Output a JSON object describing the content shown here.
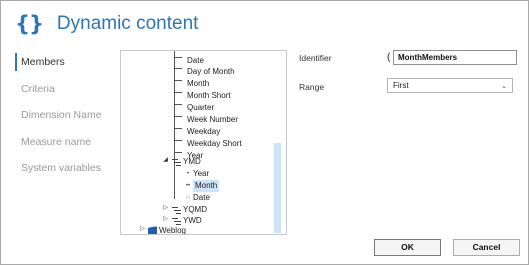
{
  "dialog": {
    "title_icon": "{}",
    "title": "Dynamic content"
  },
  "nav": {
    "items": [
      {
        "label": "Members"
      },
      {
        "label": "Criteria"
      },
      {
        "label": "Dimension Name"
      },
      {
        "label": "Measure name"
      },
      {
        "label": "System variables"
      }
    ],
    "active_index": 0
  },
  "tree": {
    "items": [
      {
        "label": "Date"
      },
      {
        "label": "Day of Month"
      },
      {
        "label": "Month"
      },
      {
        "label": "Month Short"
      },
      {
        "label": "Quarter"
      },
      {
        "label": "Week Number"
      },
      {
        "label": "Weekday"
      },
      {
        "label": "Weekday Short"
      },
      {
        "label": "Year"
      },
      {
        "label": "YMD",
        "expanded": true
      },
      {
        "label": "Year"
      },
      {
        "label": "Month",
        "selected": true
      },
      {
        "label": "Date"
      },
      {
        "label": "YQMD"
      },
      {
        "label": "YWD"
      },
      {
        "label": "Weblog"
      }
    ],
    "expander_collapsed": "▷",
    "expander_expanded": "◢"
  },
  "form": {
    "identifier_label": "Identifier",
    "identifier_open_paren": "(",
    "identifier_value": "MonthMembers",
    "range_label": "Range",
    "range_value": "First"
  },
  "buttons": {
    "ok": "OK",
    "cancel": "Cancel"
  },
  "colors": {
    "accent": "#2e75b6",
    "selection": "#cde3f7"
  }
}
